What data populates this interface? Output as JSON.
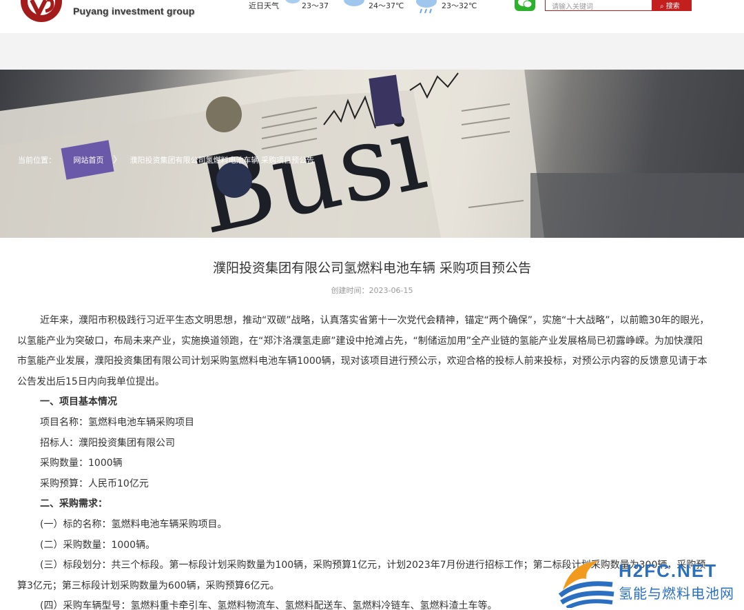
{
  "header": {
    "logo_text": "Puyang investment group",
    "weather_label": "近日天气",
    "weather": [
      {
        "icon": "cloud-sun-icon",
        "range": "23～37"
      },
      {
        "icon": "cloud-icon",
        "range": "24～37℃"
      },
      {
        "icon": "rain-cloud-icon",
        "range": "23～32℃"
      }
    ],
    "search_placeholder": "请输入关键词",
    "search_button": "搜索"
  },
  "breadcrumb": {
    "label": "当前位置：",
    "home": "网站首页",
    "current": "濮阳投资集团有限公司氢燃料电池车辆 采购项目预公告"
  },
  "article": {
    "title": "濮阳投资集团有限公司氢燃料电池车辆 采购项目预公告",
    "date": "创建时间：2023-06-15",
    "intro": "近年来，濮阳市积极践行习近平生态文明思想，推动“双碳”战略，认真落实省第十一次党代会精神，锚定“两个确保”，实施“十大战略”，以前瞻30年的眼光，以氢能产业为突破口，布局未来产业，实施换道领跑，在“郑汴洛濮氢走廊”建设中抢滩占先，“制储运加用”全产业链的氢能产业发展格局已初露峥嵘。为加快濮阳市氢能产业发展，濮阳投资集团有限公司计划采购氢燃料电池车辆1000辆，现对该项目进行预公示，欢迎合格的投标人前来投标，对预公示内容的反馈意见请于本公告发出后15日内向我单位提出。",
    "section1_heading": "一、项目基本情况",
    "project_name": "项目名称：氢燃料电池车辆采购项目",
    "tenderer": "招标人：濮阳投资集团有限公司",
    "quantity": "采购数量：1000辆",
    "budget": "采购预算：人民币10亿元",
    "section2_heading": "二、采购需求：",
    "req1": "(一）标的名称：氢燃料电池车辆采购项目。",
    "req2": "(二）采购数量：1000辆。",
    "req3": "(三）标段划分：共三个标段。第一标段计划采购数量为100辆，采购预算1亿元，计划2023年7月份进行招标工作；第二标段计划采购数量为300辆，采购预算3亿元；第三标段计划采购数量为600辆，采购预算6亿元。",
    "req4": "(四）采购车辆型号：氢燃料重卡牵引车、氢燃料物流车、氢燃料配送车、氢燃料冷链车、氢燃料渣土车等。"
  },
  "watermark": {
    "en": "H2FC.NET",
    "cn": "氢能与燃料电池网"
  },
  "colors": {
    "brand_red": "#c31f1f",
    "nav_band": "#f3f3f3",
    "watermark_blue": "#2a6fc0"
  }
}
